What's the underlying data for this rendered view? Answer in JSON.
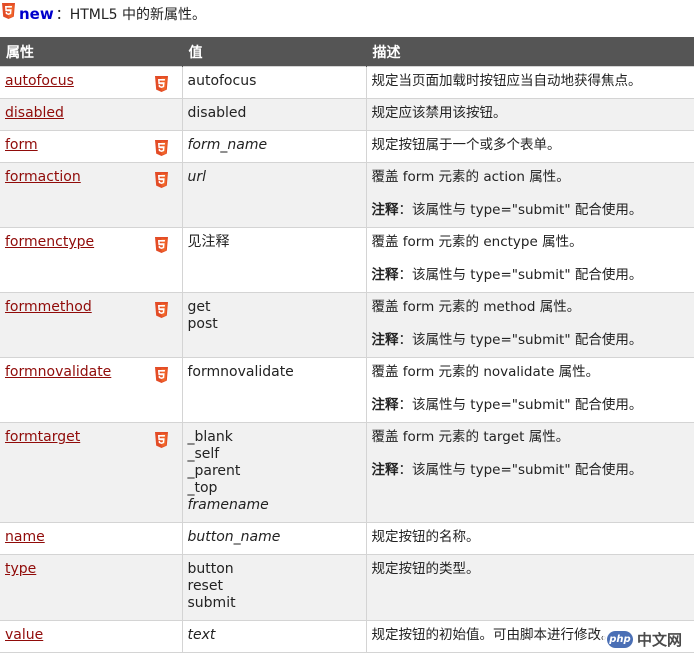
{
  "legend": {
    "new_label": "new",
    "text": "：HTML5 中的新属性。"
  },
  "header": {
    "col1": "属性",
    "col2": "值",
    "col3": "描述"
  },
  "rows": [
    {
      "attr": "autofocus",
      "html5": true,
      "values": [
        "autofocus"
      ],
      "italic": false,
      "desc": "规定当页面加载时按钮应当自动地获得焦点。",
      "note_label": "",
      "note": ""
    },
    {
      "attr": "disabled",
      "html5": false,
      "values": [
        "disabled"
      ],
      "italic": false,
      "desc": "规定应该禁用该按钮。",
      "note_label": "",
      "note": ""
    },
    {
      "attr": "form",
      "html5": true,
      "values": [
        "form_name"
      ],
      "italic": true,
      "desc": "规定按钮属于一个或多个表单。",
      "note_label": "",
      "note": ""
    },
    {
      "attr": "formaction",
      "html5": true,
      "values": [
        "url"
      ],
      "italic": true,
      "desc": "覆盖 form 元素的 action 属性。",
      "note_label": "注释",
      "note": "：该属性与 type=\"submit\" 配合使用。"
    },
    {
      "attr": "formenctype",
      "html5": true,
      "values": [
        "见注释"
      ],
      "italic": false,
      "desc": "覆盖 form 元素的 enctype 属性。",
      "note_label": "注释",
      "note": "：该属性与 type=\"submit\" 配合使用。"
    },
    {
      "attr": "formmethod",
      "html5": true,
      "values": [
        "get",
        "post"
      ],
      "italic": false,
      "desc": "覆盖 form 元素的 method 属性。",
      "note_label": "注释",
      "note": "：该属性与 type=\"submit\" 配合使用。"
    },
    {
      "attr": "formnovalidate",
      "html5": true,
      "values": [
        "formnovalidate"
      ],
      "italic": false,
      "desc": "覆盖 form 元素的 novalidate 属性。",
      "note_label": "注释",
      "note": "：该属性与 type=\"submit\" 配合使用。"
    },
    {
      "attr": "formtarget",
      "html5": true,
      "values": [
        "_blank",
        "_self",
        "_parent",
        "_top",
        "framename"
      ],
      "italic_last": true,
      "italic": false,
      "desc": "覆盖 form 元素的 target 属性。",
      "note_label": "注释",
      "note": "：该属性与 type=\"submit\" 配合使用。"
    },
    {
      "attr": "name",
      "html5": false,
      "values": [
        "button_name"
      ],
      "italic": true,
      "desc": "规定按钮的名称。",
      "note_label": "",
      "note": ""
    },
    {
      "attr": "type",
      "html5": false,
      "values": [
        "button",
        "reset",
        "submit"
      ],
      "italic": false,
      "desc": "规定按钮的类型。",
      "note_label": "",
      "note": ""
    },
    {
      "attr": "value",
      "html5": false,
      "values": [
        "text"
      ],
      "italic": true,
      "desc": "规定按钮的初始值。可由脚本进行修改。",
      "note_label": "",
      "note": ""
    }
  ],
  "watermark": {
    "badge": "php",
    "text": "中文网"
  },
  "colors": {
    "header_bg": "#555555",
    "link": "#900b09",
    "new_label": "#0000cc",
    "html5_badge": "#e34c26"
  }
}
